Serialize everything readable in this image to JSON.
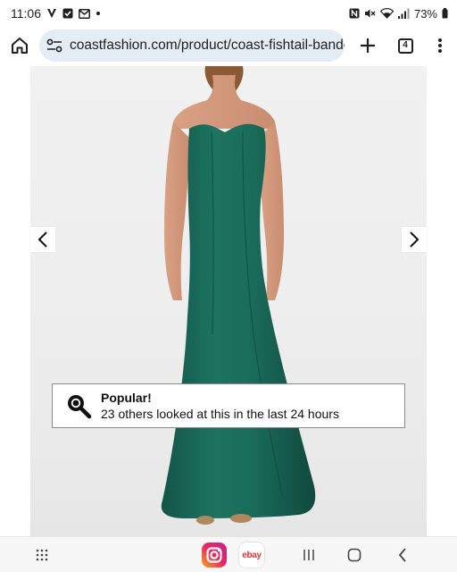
{
  "status_bar": {
    "time": "11:06",
    "battery": "73%",
    "notification_icons": [
      "v-icon",
      "check-square-icon",
      "gmail-icon",
      "dot-icon"
    ],
    "system_icons": [
      "nfc-icon",
      "mute-icon",
      "wifi-icon",
      "signal-icon",
      "battery-icon"
    ]
  },
  "browser": {
    "url": "coastfashion.com/product/coast-fishtail-bandeau",
    "tab_count": "4"
  },
  "product": {
    "image_alt": "green strapless fishtail maxi dress",
    "dress_color": "#1a6b5a"
  },
  "popular_banner": {
    "title": "Popular!",
    "message": "23 others looked at this in the last 24 hours"
  },
  "nav_bar": {
    "apps": [
      "app-drawer-icon",
      "instagram-icon",
      "ebay-icon"
    ],
    "ebay_label": "ebay",
    "buttons": [
      "recents-icon",
      "home-icon",
      "back-icon"
    ]
  }
}
